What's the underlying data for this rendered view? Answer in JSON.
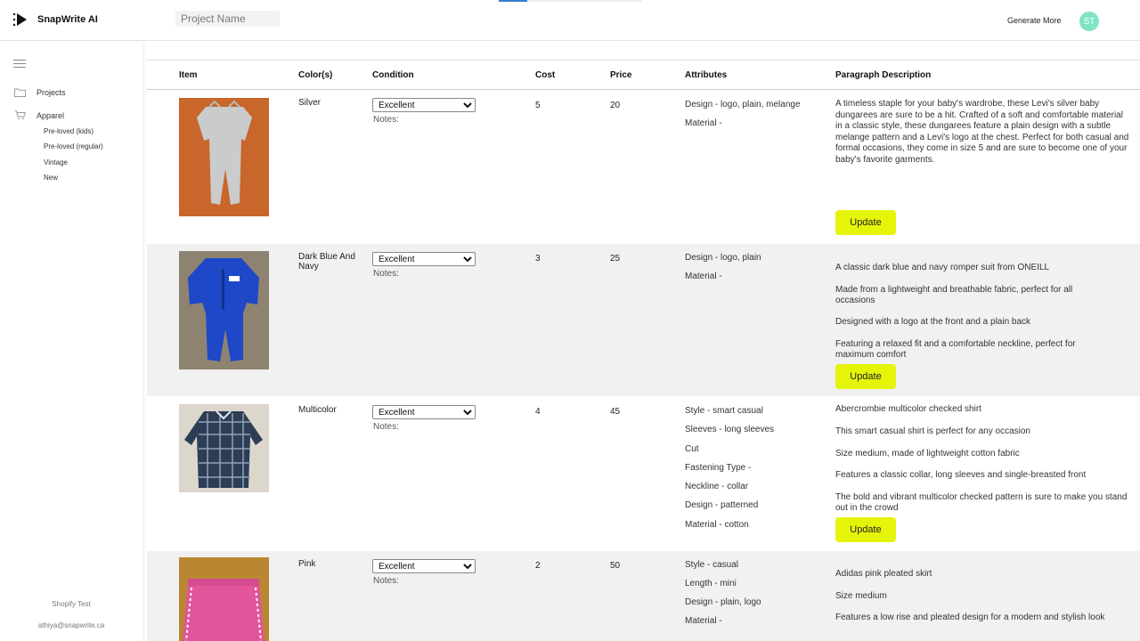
{
  "app": {
    "brand_name": "SnapWrite AI",
    "avatar_initials": "ST"
  },
  "header": {
    "project_placeholder": "Project Name",
    "generate_more_label": "Generate More",
    "progress_fraction": 0.2
  },
  "sidebar": {
    "items": [
      {
        "label": "Projects",
        "icon": "folder-icon"
      },
      {
        "label": "Apparel",
        "icon": "cart-icon"
      }
    ],
    "sub_items": [
      "Pre-loved (kids)",
      "Pre-loved (regular)",
      "Vintage",
      "New"
    ],
    "footer_store": "Shopify Test",
    "footer_email": "athiya@snapwrite.ca"
  },
  "table": {
    "columns": [
      "Item",
      "Color(s)",
      "Condition",
      "Cost",
      "Price",
      "Attributes",
      "Paragraph Description"
    ],
    "notes_label": "Notes:",
    "update_label": "Update",
    "rows": [
      {
        "color": "Silver",
        "condition": "Excellent",
        "cost": "5",
        "price": "20",
        "attributes": [
          "Design - logo, plain, melange",
          "Material -"
        ],
        "description": "A timeless staple for your baby's wardrobe, these Levi's silver baby dungarees are sure to be a hit. Crafted of a soft and comfortable material in a classic style, these dungarees feature a plain design with a subtle melange pattern and a Levi's logo at the chest. Perfect for both casual and formal occasions, they come in size 5 and are sure to become one of your baby's favorite garments."
      },
      {
        "color": "Dark Blue And Navy",
        "condition": "Excellent",
        "cost": "3",
        "price": "25",
        "attributes": [
          "Design - logo, plain",
          "Material -"
        ],
        "description_lines": [
          "A classic dark blue and navy romper suit from ONEILL",
          "Made from a lightweight and breathable fabric, perfect for all occasions",
          "Designed with a logo at the front and a plain back",
          "Featuring a relaxed fit and a comfortable neckline, perfect for maximum comfort"
        ]
      },
      {
        "color": "Multicolor",
        "condition": "Excellent",
        "cost": "4",
        "price": "45",
        "attributes": [
          "Style - smart casual",
          "Sleeves - long sleeves",
          "Cut",
          "Fastening Type -",
          "Neckline - collar",
          "Design - patterned",
          "Material - cotton"
        ],
        "description_lines": [
          "Abercrombie multicolor checked shirt",
          "This smart casual shirt is perfect for any occasion",
          "Size medium, made of lightweight cotton fabric",
          "Features a classic collar, long sleeves and single-breasted front",
          "The bold and vibrant multicolor checked pattern is sure to make you stand out in the crowd"
        ]
      },
      {
        "color": "Pink",
        "condition": "Excellent",
        "cost": "2",
        "price": "50",
        "attributes": [
          "Style - casual",
          "Length - mini",
          "Design - plain, logo",
          "Material -"
        ],
        "description_lines": [
          "Adidas pink pleated skirt",
          "Size medium",
          "Features a low rise and pleated design for a modern and stylish look"
        ]
      }
    ]
  },
  "colors": {
    "accent_button": "#e5f50a",
    "avatar": "#7fe3c6",
    "row_alt": "#f1f1f1"
  }
}
